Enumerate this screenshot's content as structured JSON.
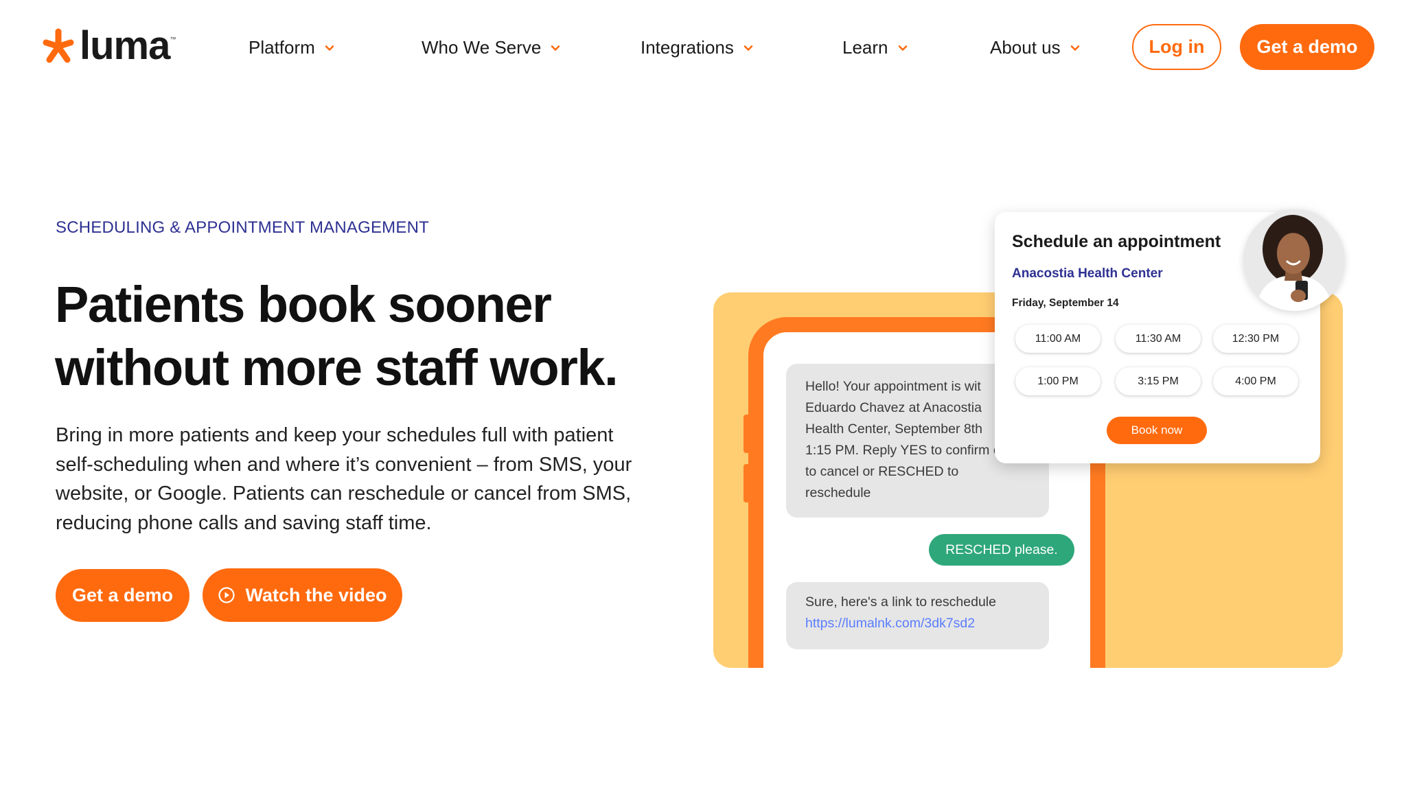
{
  "brand": {
    "name": "luma",
    "trademark": "™",
    "accent_color": "#ff6a0e",
    "navy_color": "#2e3192"
  },
  "nav": {
    "items": [
      {
        "label": "Platform"
      },
      {
        "label": "Who We Serve"
      },
      {
        "label": "Integrations"
      },
      {
        "label": "Learn"
      },
      {
        "label": "About us"
      }
    ],
    "login_label": "Log in",
    "demo_label": "Get a demo"
  },
  "hero": {
    "eyebrow": "SCHEDULING & APPOINTMENT MANAGEMENT",
    "headline_line1": "Patients book sooner",
    "headline_line2": "without more staff work.",
    "subcopy": "Bring in more patients and keep your schedules full with patient self-scheduling when and where it’s convenient – from SMS, your website, or Google. Patients can reschedule or cancel from SMS, reducing phone calls and saving staff time.",
    "demo_label": "Get a demo",
    "video_label": "Watch the video"
  },
  "sms": {
    "message_1_lines": [
      "Hello! Your appointment is wit",
      "Eduardo Chavez at Anacostia",
      "Health Center, September 8th",
      "1:15 PM. Reply YES to confirm c",
      "to cancel or RESCHED to",
      "reschedule"
    ],
    "reply": "RESCHED please.",
    "message_2": "Sure, here's a link to reschedule",
    "link": "https://lumalnk.com/3dk7sd2"
  },
  "appointment_card": {
    "title": "Schedule an appointment",
    "center": "Anacostia Health Center",
    "date": "Friday, September 14",
    "slots": [
      "11:00 AM",
      "11:30 AM",
      "12:30 PM",
      "1:00 PM",
      "3:15 PM",
      "4:00 PM"
    ],
    "book_label": "Book now"
  }
}
